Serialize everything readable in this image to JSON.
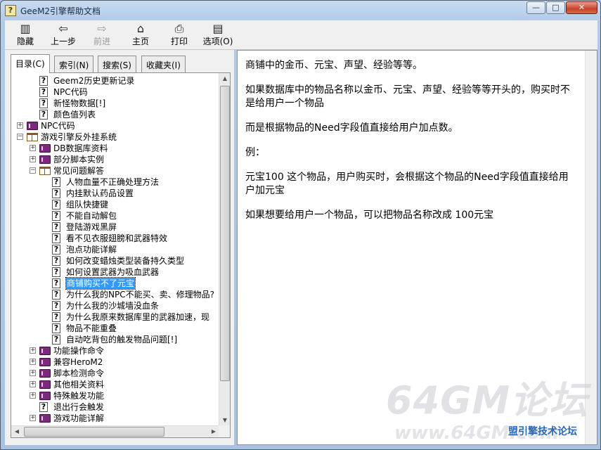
{
  "window": {
    "title": "GeeM2引擎帮助文档",
    "buttons": {
      "minimize": "—",
      "maximize": "□",
      "close": "✕"
    }
  },
  "toolbar": {
    "hide": {
      "label": "隐藏",
      "icon": "hide-icon"
    },
    "back": {
      "label": "上一步",
      "icon": "back-arrow-icon"
    },
    "forward": {
      "label": "前进",
      "icon": "forward-arrow-icon"
    },
    "home": {
      "label": "主页",
      "icon": "home-icon"
    },
    "print": {
      "label": "打印",
      "icon": "printer-icon"
    },
    "options": {
      "label": "选项(O)",
      "icon": "options-icon"
    }
  },
  "tabs": [
    "目录(C)",
    "索引(N)",
    "搜索(S)",
    "收藏夹(I)"
  ],
  "tree": [
    {
      "level": 1,
      "type": "page",
      "label": "Geem2历史更新记录"
    },
    {
      "level": 1,
      "type": "page",
      "label": "NPC代码"
    },
    {
      "level": 1,
      "type": "page",
      "label": "新怪物数据[!]"
    },
    {
      "level": 1,
      "type": "page",
      "label": "颜色值列表"
    },
    {
      "level": 0,
      "type": "book",
      "expander": "+",
      "label": "NPC代码"
    },
    {
      "level": 0,
      "type": "openbook",
      "expander": "−",
      "label": "游戏引擎反外挂系统"
    },
    {
      "level": 1,
      "type": "book",
      "expander": "+",
      "label": "DB数据库资料"
    },
    {
      "level": 1,
      "type": "book",
      "expander": "+",
      "label": "部分脚本实例"
    },
    {
      "level": 1,
      "type": "openbook",
      "expander": "−",
      "label": "常见问题解答"
    },
    {
      "level": 2,
      "type": "page",
      "label": "人物血量不正确处理方法"
    },
    {
      "level": 2,
      "type": "page",
      "label": "内挂默认药品设置"
    },
    {
      "level": 2,
      "type": "page",
      "label": "组队快捷键"
    },
    {
      "level": 2,
      "type": "page",
      "label": "不能自动解包"
    },
    {
      "level": 2,
      "type": "page",
      "label": "登陆游戏黑屏"
    },
    {
      "level": 2,
      "type": "page",
      "label": "看不见衣服翅膀和武器特效"
    },
    {
      "level": 2,
      "type": "page",
      "label": "泡点功能详解"
    },
    {
      "level": 2,
      "type": "page",
      "label": "如何改变蜡烛类型装备持久类型"
    },
    {
      "level": 2,
      "type": "page",
      "label": "如何设置武器为吸血武器"
    },
    {
      "level": 2,
      "type": "page",
      "label": "商铺购买不了元宝",
      "selected": true
    },
    {
      "level": 2,
      "type": "page",
      "label": "为什么我的NPC不能买、卖、修理物品?"
    },
    {
      "level": 2,
      "type": "page",
      "label": "为什么我的沙城墙没血条"
    },
    {
      "level": 2,
      "type": "page",
      "label": "为什么我原来数据库里的武器加速，现"
    },
    {
      "level": 2,
      "type": "page",
      "label": "物品不能重叠"
    },
    {
      "level": 2,
      "type": "page",
      "label": "自动吃背包的触发物品问题[!]"
    },
    {
      "level": 1,
      "type": "book",
      "expander": "+",
      "label": "功能操作命令"
    },
    {
      "level": 1,
      "type": "book",
      "expander": "+",
      "label": "兼容HeroM2"
    },
    {
      "level": 1,
      "type": "book",
      "expander": "+",
      "label": "脚本检测命令"
    },
    {
      "level": 1,
      "type": "book",
      "expander": "+",
      "label": "其他相关资料"
    },
    {
      "level": 1,
      "type": "book",
      "expander": "+",
      "label": "特殊触发功能"
    },
    {
      "level": 1,
      "type": "page",
      "label": "退出行会触发"
    },
    {
      "level": 1,
      "type": "book",
      "expander": "+",
      "label": "游戏功能详解"
    }
  ],
  "content": {
    "paragraphs": [
      "商铺中的金币、元宝、声望、经验等等。",
      "如果数据库中的物品名称以金币、元宝、声望、经验等等开头的，购买时不是给用户一个物品",
      "而是根据物品的Need字段值直接给用户加点数。",
      "例：",
      "元宝100 这个物品，用户购买时，会根据这个物品的Need字段值直接给用户加元宝",
      "如果想要给用户一个物品，可以把物品名称改成 100元宝"
    ]
  },
  "watermark": {
    "big": "64GM论坛",
    "small": "www.64GM.com",
    "forum": "盟引擎技术论坛"
  }
}
